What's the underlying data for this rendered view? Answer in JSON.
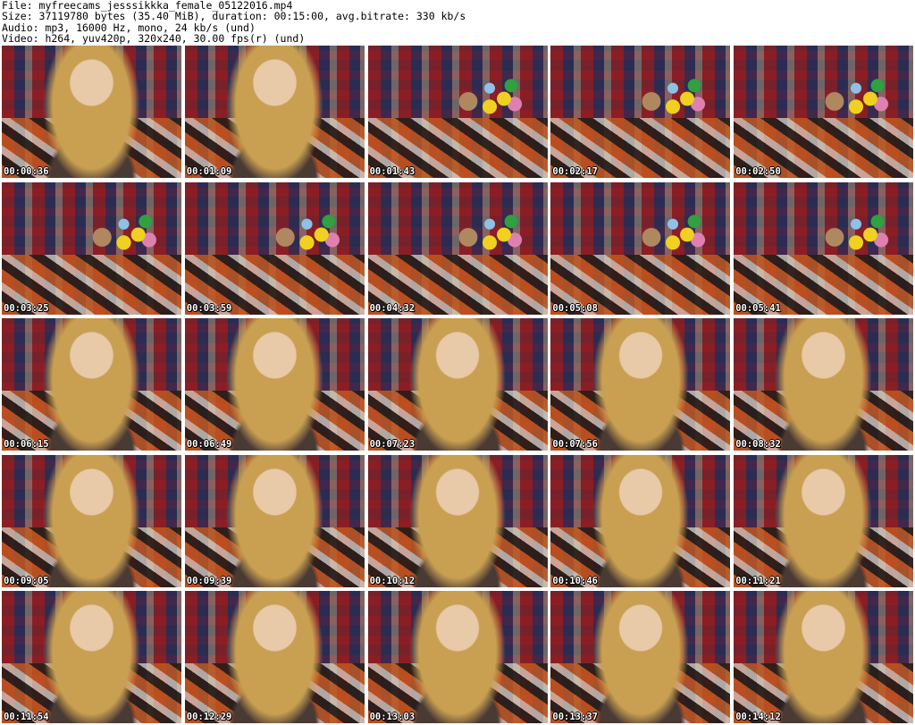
{
  "header": {
    "file": "File: myfreecams_jesssikkka_female_05122016.mp4",
    "size": "Size: 37119780 bytes (35.40 MiB), duration: 00:15:00, avg.bitrate: 330 kb/s",
    "audio": "Audio: mp3, 16000 Hz, mono, 24 kb/s (und)",
    "video": "Video: h264, yuv420p, 320x240, 30.00 fps(r) (und)"
  },
  "thumbnails": [
    {
      "time": "00:00:36",
      "scene": false
    },
    {
      "time": "00:01:09",
      "scene": false
    },
    {
      "time": "00:01:43",
      "scene": true
    },
    {
      "time": "00:02:17",
      "scene": true
    },
    {
      "time": "00:02:50",
      "scene": true
    },
    {
      "time": "00:03:25",
      "scene": true
    },
    {
      "time": "00:03:59",
      "scene": true
    },
    {
      "time": "00:04:32",
      "scene": true
    },
    {
      "time": "00:05:08",
      "scene": true
    },
    {
      "time": "00:05:41",
      "scene": true
    },
    {
      "time": "00:06:15",
      "scene": false
    },
    {
      "time": "00:06:49",
      "scene": false
    },
    {
      "time": "00:07:23",
      "scene": false
    },
    {
      "time": "00:07:56",
      "scene": false
    },
    {
      "time": "00:08:32",
      "scene": false
    },
    {
      "time": "00:09:05",
      "scene": false
    },
    {
      "time": "00:09:39",
      "scene": false
    },
    {
      "time": "00:10:12",
      "scene": false
    },
    {
      "time": "00:10:46",
      "scene": false
    },
    {
      "time": "00:11:21",
      "scene": false
    },
    {
      "time": "00:11:54",
      "scene": false
    },
    {
      "time": "00:12:29",
      "scene": false
    },
    {
      "time": "00:13:03",
      "scene": false
    },
    {
      "time": "00:13:37",
      "scene": false
    },
    {
      "time": "00:14:12",
      "scene": false
    }
  ]
}
